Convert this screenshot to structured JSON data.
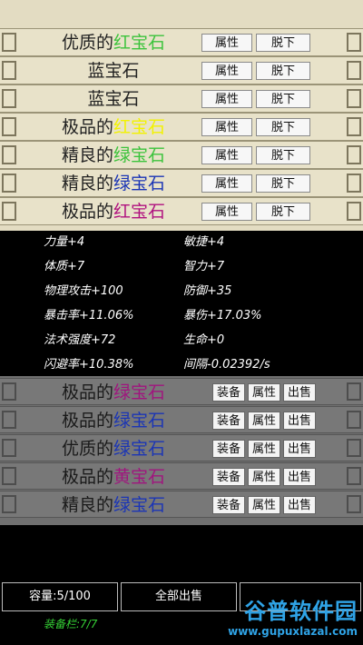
{
  "equipped": {
    "items": [
      {
        "prefix": "优质的",
        "name": "红宝石",
        "name_color": "#3cc33c",
        "attr": "属性",
        "unequip": "脱下"
      },
      {
        "prefix": "",
        "name": "蓝宝石",
        "name_color": "#222222",
        "attr": "属性",
        "unequip": "脱下"
      },
      {
        "prefix": "",
        "name": "蓝宝石",
        "name_color": "#222222",
        "attr": "属性",
        "unequip": "脱下"
      },
      {
        "prefix": "极品的",
        "name": "红宝石",
        "name_color": "#f2f200",
        "attr": "属性",
        "unequip": "脱下"
      },
      {
        "prefix": "精良的",
        "name": "绿宝石",
        "name_color": "#3cc33c",
        "attr": "属性",
        "unequip": "脱下"
      },
      {
        "prefix": "精良的",
        "name": "绿宝石",
        "name_color": "#1b35b5",
        "attr": "属性",
        "unequip": "脱下"
      },
      {
        "prefix": "极品的",
        "name": "红宝石",
        "name_color": "#b0117f",
        "attr": "属性",
        "unequip": "脱下"
      }
    ]
  },
  "stats": {
    "left": [
      "力量+4",
      "体质+7",
      "物理攻击+100",
      "暴击率+11.06%",
      "法术强度+72",
      "闪避率+10.38%"
    ],
    "right": [
      "敏捷+4",
      "智力+7",
      "防御+35",
      "暴伤+17.03%",
      "生命+0",
      "间隔-0.02392/s"
    ]
  },
  "bag": {
    "items": [
      {
        "prefix": "极品的",
        "name": "绿宝石",
        "name_color": "#a0157e",
        "equip": "装备",
        "attr": "属性",
        "sell": "出售"
      },
      {
        "prefix": "极品的",
        "name": "绿宝石",
        "name_color": "#1b35b5",
        "equip": "装备",
        "attr": "属性",
        "sell": "出售"
      },
      {
        "prefix": "优质的",
        "name": "绿宝石",
        "name_color": "#1b35b5",
        "equip": "装备",
        "attr": "属性",
        "sell": "出售"
      },
      {
        "prefix": "极品的",
        "name": "黄宝石",
        "name_color": "#a0157e",
        "equip": "装备",
        "attr": "属性",
        "sell": "出售"
      },
      {
        "prefix": "精良的",
        "name": "绿宝石",
        "name_color": "#1b35b5",
        "equip": "装备",
        "attr": "属性",
        "sell": "出售"
      }
    ]
  },
  "footer": {
    "capacity": "容量:5/100",
    "sell_all": "全部出售",
    "slots": "装备栏:7/7"
  },
  "watermark": {
    "main": "谷普软件园",
    "sub": "www.gupuxlazal.com"
  }
}
